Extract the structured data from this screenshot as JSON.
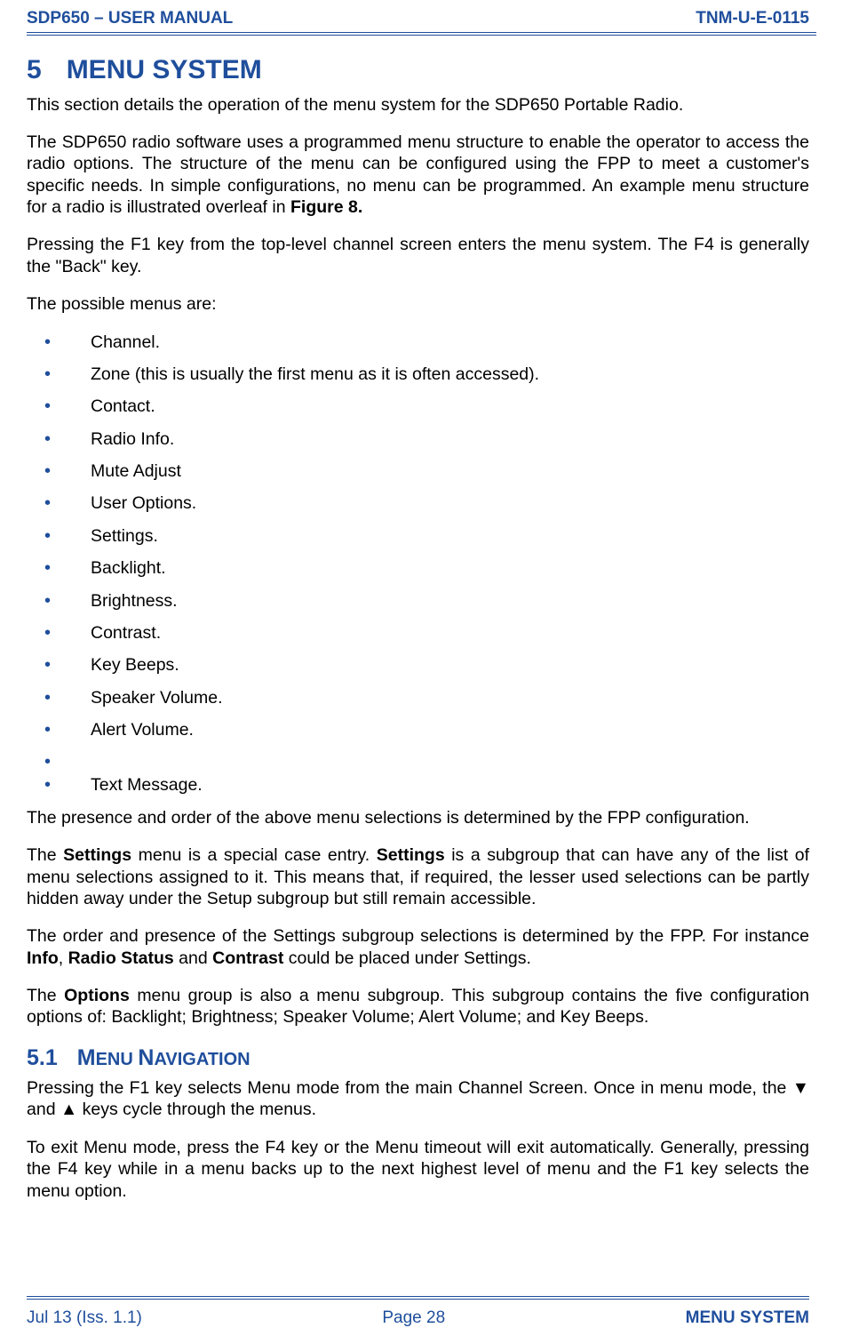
{
  "header": {
    "left": "SDP650 – USER MANUAL",
    "right": "TNM-U-E-0115"
  },
  "section5": {
    "num": "5",
    "title": "MENU SYSTEM",
    "intro": "This section details the operation of the menu system for the SDP650 Portable Radio.",
    "p2_a": "The SDP650 radio software uses a programmed menu structure to enable the operator to access the radio options.  The structure of the menu can be configured using the FPP to meet a customer's specific needs.  In simple configurations, no menu can be programmed.  An example menu structure for a radio is illustrated overleaf in ",
    "p2_b_bold": "Figure 8.",
    "p3": "Pressing the F1 key from the top-level channel screen enters the menu system.  The F4 is generally the \"Back\" key.",
    "p4": "The possible menus are:",
    "menus": [
      "Channel.",
      "Zone (this is usually the first menu as it is often accessed).",
      "Contact.",
      "Radio Info.",
      "Mute Adjust",
      "User Options.",
      "Settings.",
      "Backlight.",
      "Brightness.",
      "Contrast.",
      "Key Beeps.",
      "Speaker Volume.",
      "Alert Volume.",
      "",
      "Text Message."
    ],
    "p5": "The presence and order of the above menu selections is determined by the FPP configuration.",
    "p6_a": "The ",
    "p6_b_bold": "Settings",
    "p6_c": " menu is a special case entry.  ",
    "p6_d_bold": "Settings",
    "p6_e": " is a subgroup that can have any of the list of menu selections assigned to it.  This means that, if required, the lesser used selections can be partly hidden away under the Setup subgroup but still remain accessible.",
    "p7_a": "The order and presence of the Settings subgroup selections is determined by the FPP.  For instance ",
    "p7_b_bold": "Info",
    "p7_c": ", ",
    "p7_d_bold": "Radio Status",
    "p7_e": " and ",
    "p7_f_bold": "Contrast",
    "p7_g": " could be placed under Settings.",
    "p8_a": "The ",
    "p8_b_bold": "Options",
    "p8_c": " menu group is also a menu subgroup.  This subgroup contains the five configuration options of: Backlight; Brightness; Speaker Volume; Alert Volume; and Key Beeps."
  },
  "section51": {
    "num": "5.1",
    "title_caps": "M",
    "title_sc": "ENU ",
    "title_caps2": "N",
    "title_sc2": "AVIGATION",
    "p1": "Pressing the F1 key selects Menu mode from the main Channel Screen.  Once in menu mode, the ▼ and ▲ keys cycle through the menus.",
    "p2": "To exit Menu mode, press the F4 key or the Menu timeout will exit automatically.  Generally, pressing the F4 key while in a menu backs up to the next highest level of menu and the F1 key selects the menu option."
  },
  "footer": {
    "left": "Jul 13 (Iss. 1.1)",
    "center": "Page 28",
    "right": "MENU SYSTEM"
  }
}
